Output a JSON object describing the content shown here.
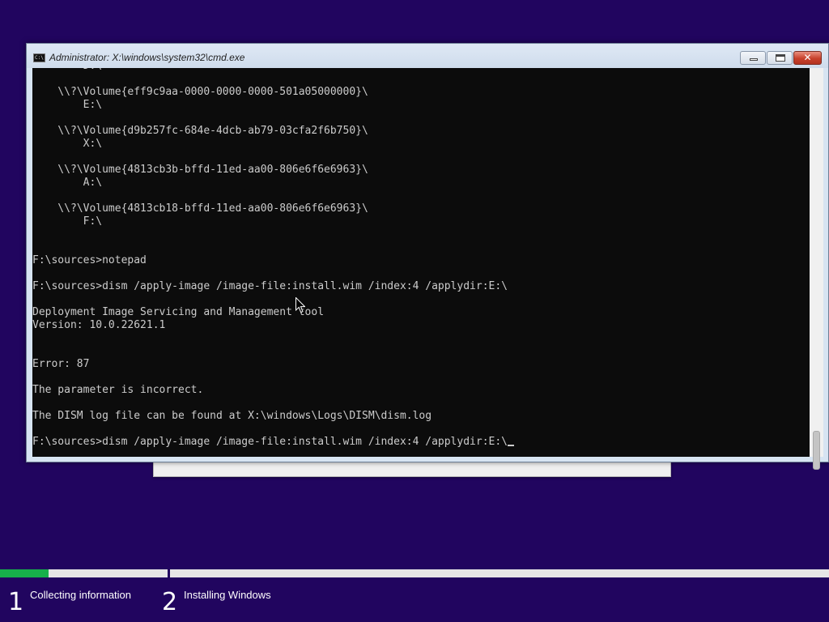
{
  "window": {
    "title": "Administrator: X:\\windows\\system32\\cmd.exe",
    "icon": "cmd-icon",
    "buttons": {
      "minimize": "minimize-icon",
      "maximize": "maximize-icon",
      "close": "close-icon"
    }
  },
  "console": {
    "lines": [
      "        D:\\",
      "",
      "    \\\\?\\Volume{eff9c9aa-0000-0000-0000-501a05000000}\\",
      "        E:\\",
      "",
      "    \\\\?\\Volume{d9b257fc-684e-4dcb-ab79-03cfa2f6b750}\\",
      "        X:\\",
      "",
      "    \\\\?\\Volume{4813cb3b-bffd-11ed-aa00-806e6f6e6963}\\",
      "        A:\\",
      "",
      "    \\\\?\\Volume{4813cb18-bffd-11ed-aa00-806e6f6e6963}\\",
      "        F:\\",
      "",
      "",
      "F:\\sources>notepad",
      "",
      "F:\\sources>dism /apply-image /image-file:install.wim /index:4 /applydir:E:\\",
      "",
      "Deployment Image Servicing and Management tool",
      "Version: 10.0.22621.1",
      "",
      "",
      "Error: 87",
      "",
      "The parameter is incorrect.",
      "",
      "The DISM log file can be found at X:\\windows\\Logs\\DISM\\dism.log",
      ""
    ],
    "prompt_line": "F:\\sources>dism /apply-image /image-file:install.wim /index:4 /applydir:E:\\"
  },
  "setup": {
    "progress_fraction": 0.29,
    "steps": [
      {
        "number": "1",
        "label": "Collecting information"
      },
      {
        "number": "2",
        "label": "Installing Windows"
      }
    ]
  },
  "colors": {
    "background": "#21055f",
    "console_bg": "#0c0c0c",
    "console_fg": "#cccccc",
    "progress_fill": "#17b04a"
  }
}
